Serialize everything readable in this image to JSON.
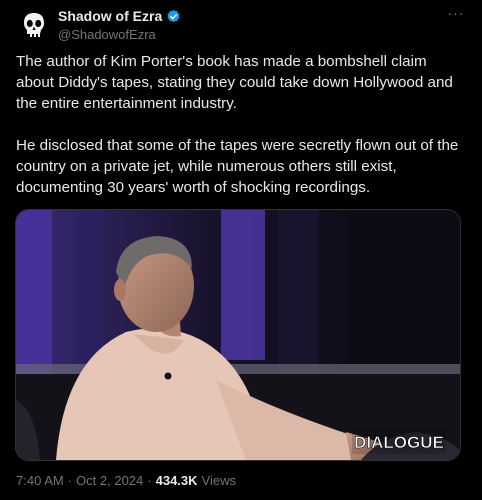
{
  "post": {
    "author": {
      "display_name": "Shadow of Ezra",
      "handle": "@ShadowofEzra",
      "verified": true,
      "avatar_icon": "punisher-skull-icon"
    },
    "more_icon": "more-options-icon",
    "text": {
      "paragraph_1": "The author of Kim Porter's book has made a bombshell claim about Diddy's tapes, stating they could take down Hollywood and the entire entertainment industry.",
      "paragraph_2": "He disclosed that some of the tapes were secretly flown out of the country on a private jet, while numerous others still exist, documenting 30 years' worth of shocking recordings."
    },
    "media": {
      "watermark": "DIALOGUE"
    },
    "meta": {
      "time": "7:40 AM",
      "separator": "·",
      "date": "Oct 2, 2024",
      "views_count": "434.3K",
      "views_label": "Views"
    },
    "colors": {
      "background": "#000000",
      "text": "#e7e9ea",
      "secondary": "#71767b",
      "verified": "#1d9bf0"
    }
  }
}
